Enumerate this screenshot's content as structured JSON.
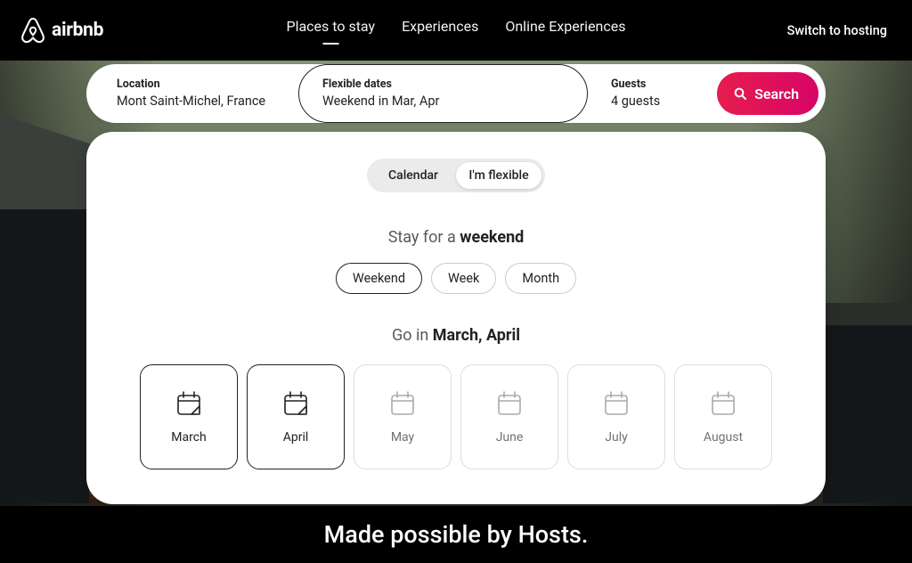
{
  "brand": "airbnb",
  "nav": {
    "tabs": [
      "Places to stay",
      "Experiences",
      "Online Experiences"
    ],
    "active_index": 0,
    "switch_hosting": "Switch to hosting"
  },
  "search": {
    "location": {
      "label": "Location",
      "value": "Mont Saint-Michel, France"
    },
    "dates": {
      "label": "Flexible dates",
      "value": "Weekend in Mar, Apr"
    },
    "guests": {
      "label": "Guests",
      "value": "4 guests"
    },
    "button": "Search"
  },
  "flexible": {
    "mode": {
      "options": [
        "Calendar",
        "I'm flexible"
      ],
      "active_index": 1
    },
    "stay_prefix": "Stay for a ",
    "stay_value": "weekend",
    "durations": [
      "Weekend",
      "Week",
      "Month"
    ],
    "duration_active_index": 0,
    "go_prefix": "Go in ",
    "go_value": "March, April",
    "months": [
      "March",
      "April",
      "May",
      "June",
      "July",
      "August"
    ],
    "month_selected": [
      true,
      true,
      false,
      false,
      false,
      false
    ]
  },
  "tagline": "Made possible by Hosts."
}
